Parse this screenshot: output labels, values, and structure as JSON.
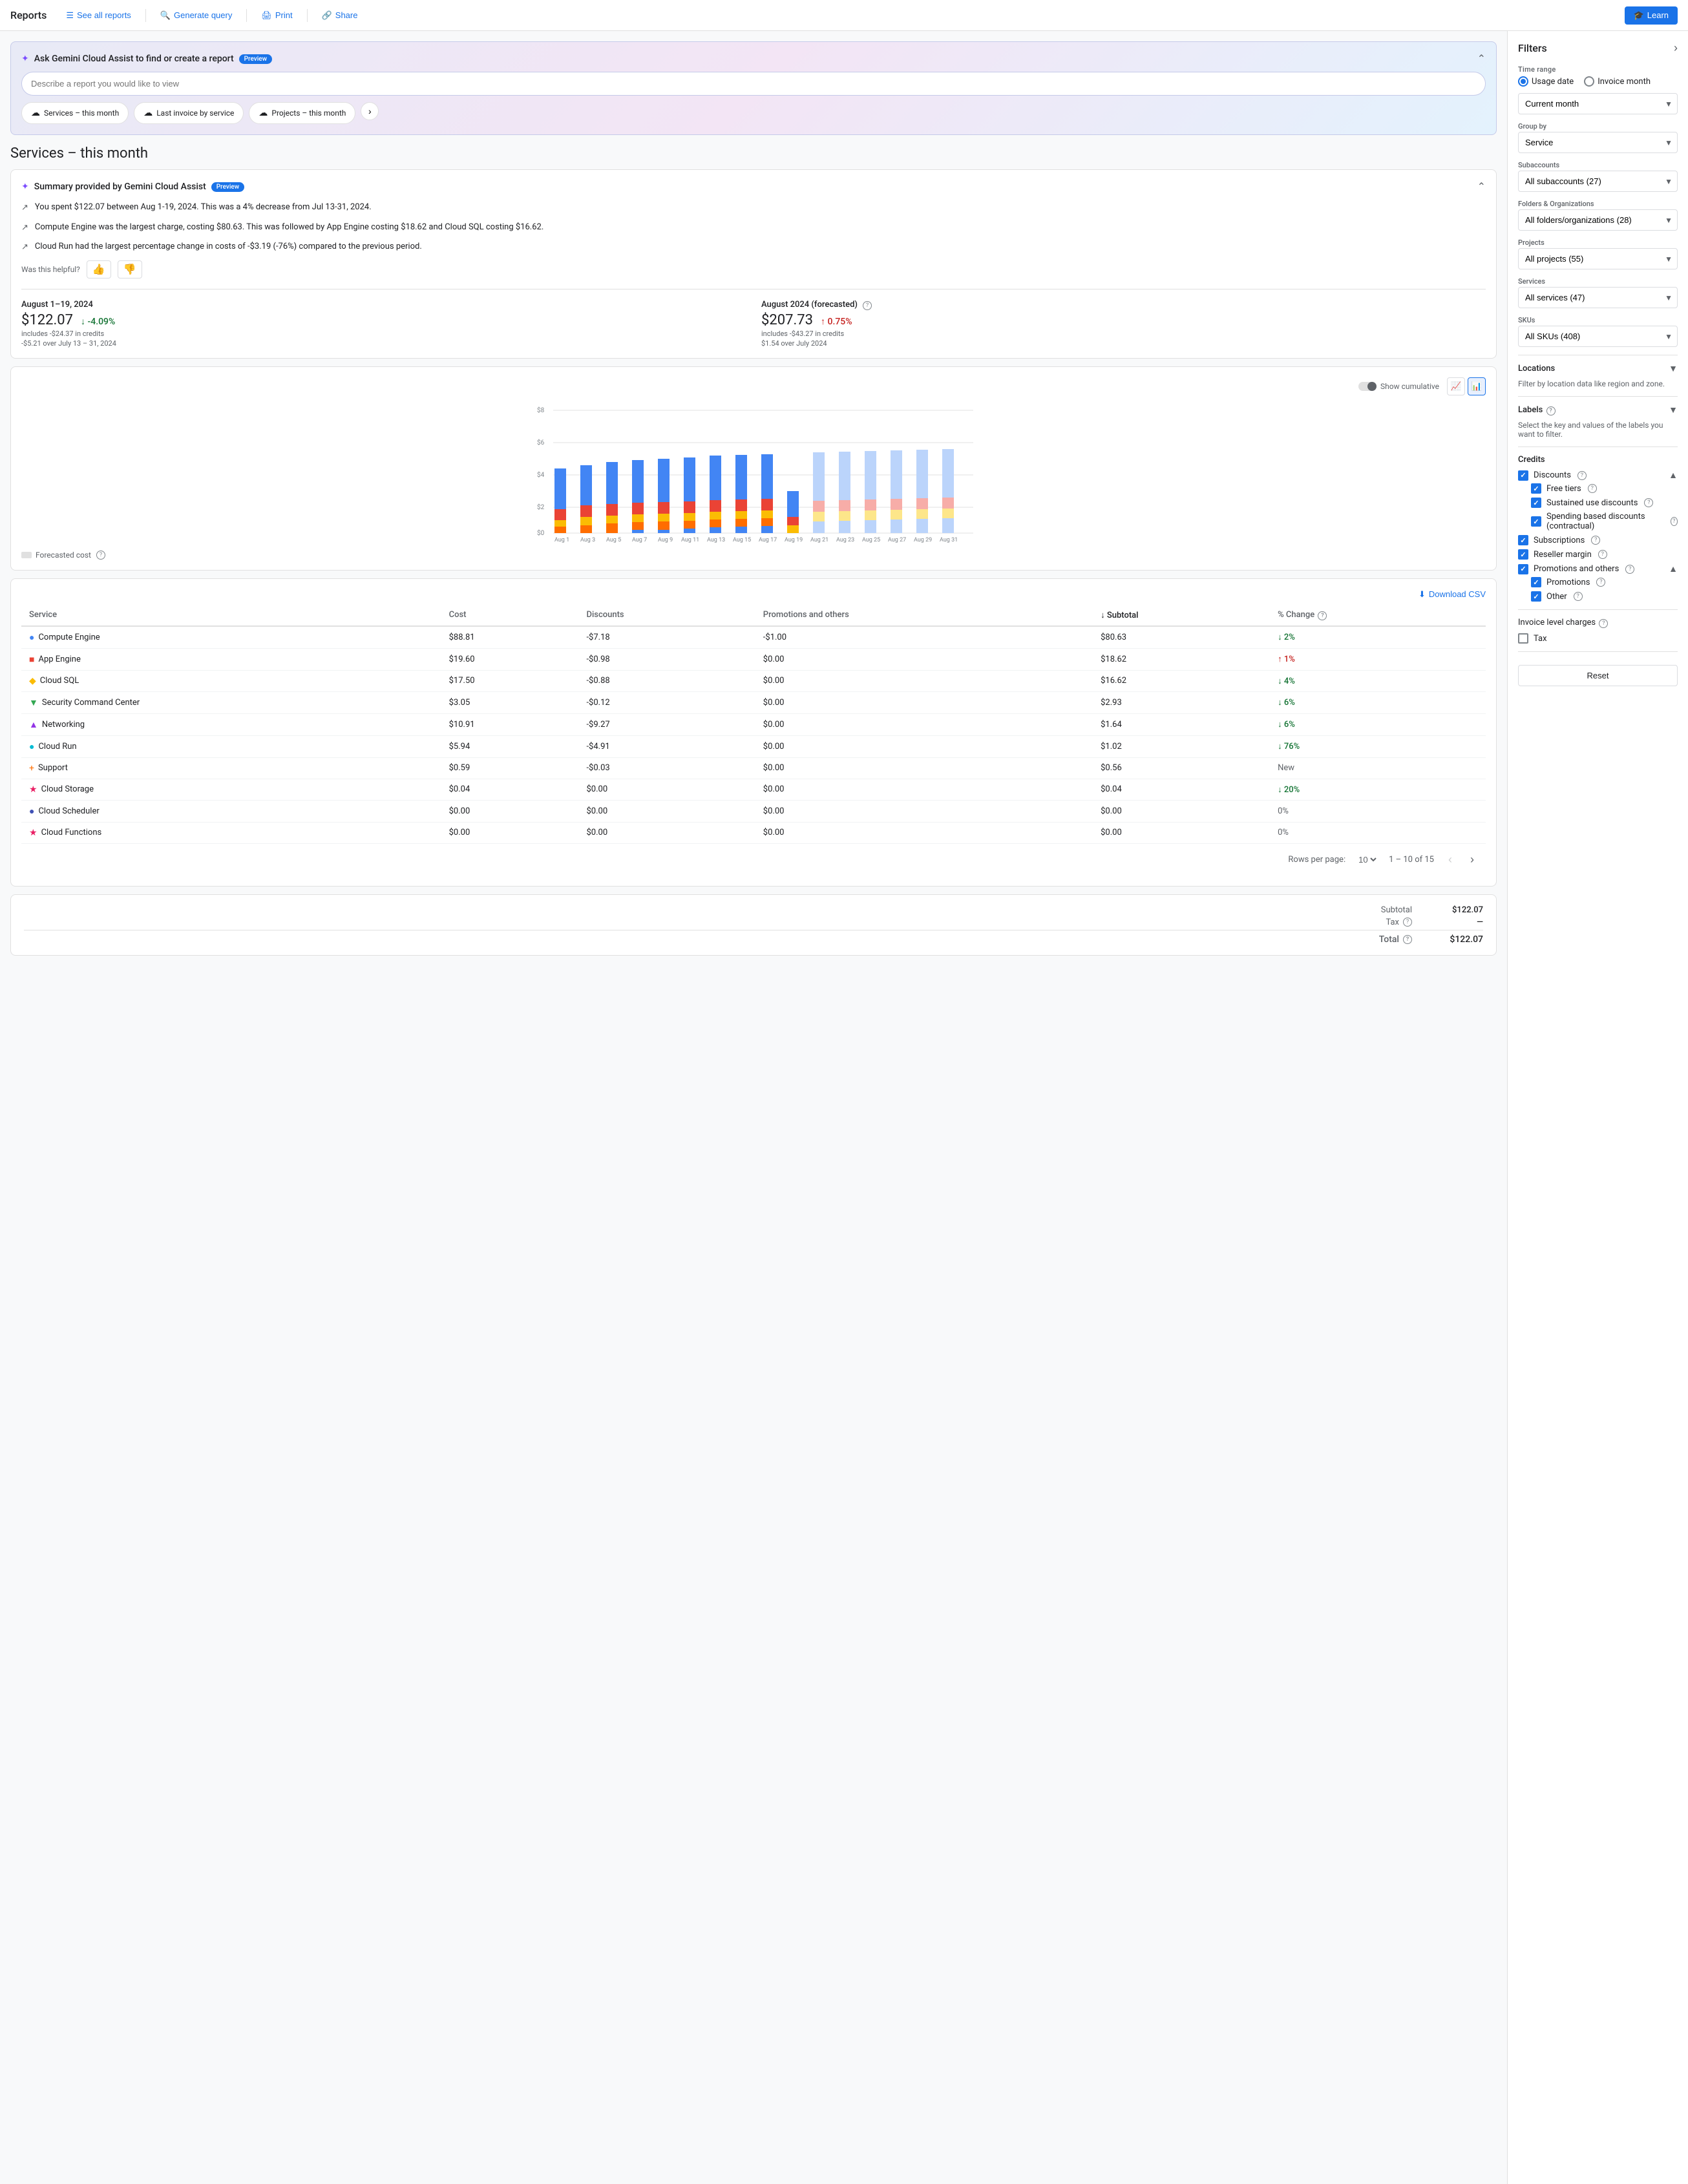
{
  "nav": {
    "brand": "Reports",
    "see_all_reports": "See all reports",
    "generate_query": "Generate query",
    "print": "Print",
    "share": "Share",
    "learn": "Learn"
  },
  "gemini": {
    "title": "Ask Gemini Cloud Assist to find or create a report",
    "preview_badge": "Preview",
    "input_placeholder": "Describe a report you would like to view",
    "chips": [
      {
        "label": "Services – this month",
        "id": "chip-services"
      },
      {
        "label": "Last invoice by service",
        "id": "chip-last-invoice"
      },
      {
        "label": "Projects – this month",
        "id": "chip-projects"
      }
    ]
  },
  "page_title": "Services – this month",
  "summary": {
    "title": "Summary provided by Gemini Cloud Assist",
    "preview_badge": "Preview",
    "items": [
      "You spent $122.07 between Aug 1-19, 2024. This was a 4% decrease from Jul 13-31, 2024.",
      "Compute Engine was the largest charge, costing $80.63. This was followed by App Engine costing $18.62 and Cloud SQL costing $16.62.",
      "Cloud Run had the largest percentage change in costs of -$3.19 (-76%) compared to the previous period."
    ],
    "feedback_label": "Was this helpful?"
  },
  "metrics": {
    "current": {
      "period": "August 1–19, 2024",
      "value": "$122.07",
      "sub": "includes -$24.37 in credits",
      "change": "-4.09%",
      "change_direction": "down",
      "change_sub": "-$5.21 over July 13 – 31, 2024"
    },
    "forecasted": {
      "period": "August 2024 (forecasted)",
      "value": "$207.73",
      "sub": "includes -$43.27 in credits",
      "change": "0.75%",
      "change_direction": "up",
      "change_sub": "$1.54 over July 2024"
    }
  },
  "chart": {
    "y_label": "$8",
    "y_labels": [
      "$8",
      "$6",
      "$4",
      "$2",
      "$0"
    ],
    "show_cumulative": "Show cumulative",
    "forecasted_label": "Forecasted cost",
    "x_labels": [
      "Aug 1",
      "Aug 3",
      "Aug 5",
      "Aug 7",
      "Aug 9",
      "Aug 11",
      "Aug 13",
      "Aug 15",
      "Aug 17",
      "Aug 19",
      "Aug 21",
      "Aug 23",
      "Aug 25",
      "Aug 27",
      "Aug 29",
      "Aug 31"
    ]
  },
  "table": {
    "download_csv": "Download CSV",
    "columns": [
      "Service",
      "Cost",
      "Discounts",
      "Promotions and others",
      "Subtotal",
      "% Change"
    ],
    "rows": [
      {
        "service": "Compute Engine",
        "color": "#4285f4",
        "shape": "circle",
        "cost": "$88.81",
        "discounts": "-$7.18",
        "promotions": "-$1.00",
        "subtotal": "$80.63",
        "change": "2%",
        "change_dir": "down"
      },
      {
        "service": "App Engine",
        "color": "#ea4335",
        "shape": "square",
        "cost": "$19.60",
        "discounts": "-$0.98",
        "promotions": "$0.00",
        "subtotal": "$18.62",
        "change": "1%",
        "change_dir": "up"
      },
      {
        "service": "Cloud SQL",
        "color": "#fbbc04",
        "shape": "diamond",
        "cost": "$17.50",
        "discounts": "-$0.88",
        "promotions": "$0.00",
        "subtotal": "$16.62",
        "change": "4%",
        "change_dir": "down"
      },
      {
        "service": "Security Command Center",
        "color": "#34a853",
        "shape": "triangle",
        "cost": "$3.05",
        "discounts": "-$0.12",
        "promotions": "$0.00",
        "subtotal": "$2.93",
        "change": "6%",
        "change_dir": "down"
      },
      {
        "service": "Networking",
        "color": "#9334e6",
        "shape": "triangle-up",
        "cost": "$10.91",
        "discounts": "-$9.27",
        "promotions": "$0.00",
        "subtotal": "$1.64",
        "change": "6%",
        "change_dir": "down"
      },
      {
        "service": "Cloud Run",
        "color": "#00bcd4",
        "shape": "circle",
        "cost": "$5.94",
        "discounts": "-$4.91",
        "promotions": "$0.00",
        "subtotal": "$1.02",
        "change": "76%",
        "change_dir": "down"
      },
      {
        "service": "Support",
        "color": "#ff6d00",
        "shape": "plus",
        "cost": "$0.59",
        "discounts": "-$0.03",
        "promotions": "$0.00",
        "subtotal": "$0.56",
        "change": "New",
        "change_dir": "neutral"
      },
      {
        "service": "Cloud Storage",
        "color": "#e91e63",
        "shape": "star",
        "cost": "$0.04",
        "discounts": "$0.00",
        "promotions": "$0.00",
        "subtotal": "$0.04",
        "change": "20%",
        "change_dir": "down"
      },
      {
        "service": "Cloud Scheduler",
        "color": "#3f51b5",
        "shape": "circle",
        "cost": "$0.00",
        "discounts": "$0.00",
        "promotions": "$0.00",
        "subtotal": "$0.00",
        "change": "0%",
        "change_dir": "neutral"
      },
      {
        "service": "Cloud Functions",
        "color": "#e91e63",
        "shape": "star",
        "cost": "$0.00",
        "discounts": "$0.00",
        "promotions": "$0.00",
        "subtotal": "$0.00",
        "change": "0%",
        "change_dir": "neutral"
      }
    ],
    "pagination": {
      "rows_per_page": "10",
      "range": "1 – 10 of 15",
      "rows_label": "Rows per page:"
    }
  },
  "totals": {
    "subtotal_label": "Subtotal",
    "subtotal_value": "$122.07",
    "tax_label": "Tax",
    "tax_help": true,
    "tax_value": "—",
    "total_label": "Total",
    "total_help": true,
    "total_value": "$122.07"
  },
  "filters": {
    "title": "Filters",
    "time_range": {
      "label": "Time range",
      "options": [
        "Usage date",
        "Invoice month"
      ],
      "selected": "Usage date"
    },
    "current_month": "Current month",
    "group_by": {
      "label": "Group by",
      "selected": "Service"
    },
    "subaccounts": {
      "label": "Subaccounts",
      "selected": "All subaccounts (27)"
    },
    "folders_orgs": {
      "label": "Folders & Organizations",
      "selected": "All folders/organizations (28)"
    },
    "projects": {
      "label": "Projects",
      "selected": "All projects (55)"
    },
    "services": {
      "label": "Services",
      "selected": "All services (47)"
    },
    "skus": {
      "label": "SKUs",
      "selected": "All SKUs (408)"
    },
    "locations": {
      "label": "Locations",
      "note": "Filter by location data like region and zone."
    },
    "labels": {
      "label": "Labels",
      "note": "Select the key and values of the labels you want to filter."
    },
    "credits": {
      "label": "Credits",
      "discounts": {
        "label": "Discounts",
        "checked": true,
        "children": [
          {
            "label": "Free tiers",
            "checked": true
          },
          {
            "label": "Sustained use discounts",
            "checked": true
          },
          {
            "label": "Spending based discounts (contractual)",
            "checked": true
          }
        ]
      },
      "subscriptions": {
        "label": "Subscriptions",
        "checked": true
      },
      "reseller_margin": {
        "label": "Reseller margin",
        "checked": true
      },
      "promotions_others": {
        "label": "Promotions and others",
        "checked": true,
        "expanded": true,
        "children": [
          {
            "label": "Promotions",
            "checked": true
          },
          {
            "label": "Other",
            "checked": true
          }
        ]
      }
    },
    "invoice_level_charges": {
      "label": "Invoice level charges",
      "tax": {
        "label": "Tax",
        "checked": false
      }
    },
    "reset_label": "Reset"
  }
}
